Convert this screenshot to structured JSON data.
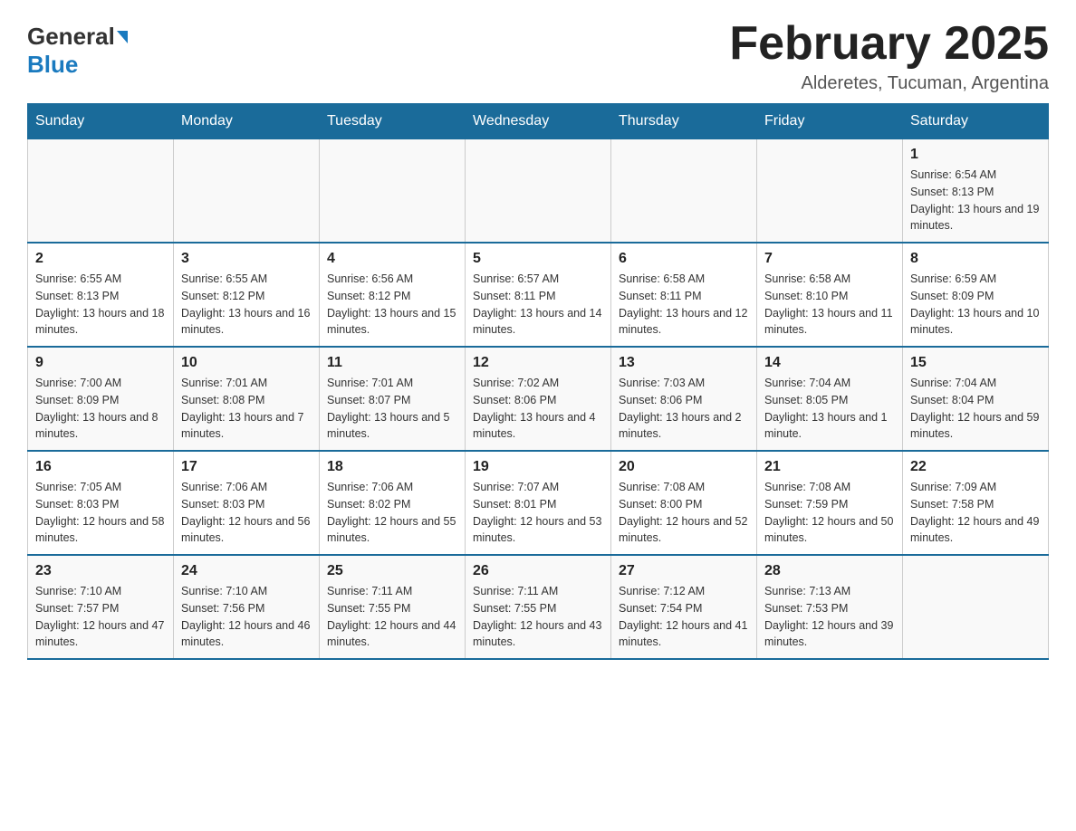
{
  "logo": {
    "general": "General",
    "blue": "Blue",
    "subtitle": "Blue"
  },
  "title": "February 2025",
  "location": "Alderetes, Tucuman, Argentina",
  "weekdays": [
    "Sunday",
    "Monday",
    "Tuesday",
    "Wednesday",
    "Thursday",
    "Friday",
    "Saturday"
  ],
  "weeks": [
    [
      {
        "day": "",
        "info": ""
      },
      {
        "day": "",
        "info": ""
      },
      {
        "day": "",
        "info": ""
      },
      {
        "day": "",
        "info": ""
      },
      {
        "day": "",
        "info": ""
      },
      {
        "day": "",
        "info": ""
      },
      {
        "day": "1",
        "info": "Sunrise: 6:54 AM\nSunset: 8:13 PM\nDaylight: 13 hours and 19 minutes."
      }
    ],
    [
      {
        "day": "2",
        "info": "Sunrise: 6:55 AM\nSunset: 8:13 PM\nDaylight: 13 hours and 18 minutes."
      },
      {
        "day": "3",
        "info": "Sunrise: 6:55 AM\nSunset: 8:12 PM\nDaylight: 13 hours and 16 minutes."
      },
      {
        "day": "4",
        "info": "Sunrise: 6:56 AM\nSunset: 8:12 PM\nDaylight: 13 hours and 15 minutes."
      },
      {
        "day": "5",
        "info": "Sunrise: 6:57 AM\nSunset: 8:11 PM\nDaylight: 13 hours and 14 minutes."
      },
      {
        "day": "6",
        "info": "Sunrise: 6:58 AM\nSunset: 8:11 PM\nDaylight: 13 hours and 12 minutes."
      },
      {
        "day": "7",
        "info": "Sunrise: 6:58 AM\nSunset: 8:10 PM\nDaylight: 13 hours and 11 minutes."
      },
      {
        "day": "8",
        "info": "Sunrise: 6:59 AM\nSunset: 8:09 PM\nDaylight: 13 hours and 10 minutes."
      }
    ],
    [
      {
        "day": "9",
        "info": "Sunrise: 7:00 AM\nSunset: 8:09 PM\nDaylight: 13 hours and 8 minutes."
      },
      {
        "day": "10",
        "info": "Sunrise: 7:01 AM\nSunset: 8:08 PM\nDaylight: 13 hours and 7 minutes."
      },
      {
        "day": "11",
        "info": "Sunrise: 7:01 AM\nSunset: 8:07 PM\nDaylight: 13 hours and 5 minutes."
      },
      {
        "day": "12",
        "info": "Sunrise: 7:02 AM\nSunset: 8:06 PM\nDaylight: 13 hours and 4 minutes."
      },
      {
        "day": "13",
        "info": "Sunrise: 7:03 AM\nSunset: 8:06 PM\nDaylight: 13 hours and 2 minutes."
      },
      {
        "day": "14",
        "info": "Sunrise: 7:04 AM\nSunset: 8:05 PM\nDaylight: 13 hours and 1 minute."
      },
      {
        "day": "15",
        "info": "Sunrise: 7:04 AM\nSunset: 8:04 PM\nDaylight: 12 hours and 59 minutes."
      }
    ],
    [
      {
        "day": "16",
        "info": "Sunrise: 7:05 AM\nSunset: 8:03 PM\nDaylight: 12 hours and 58 minutes."
      },
      {
        "day": "17",
        "info": "Sunrise: 7:06 AM\nSunset: 8:03 PM\nDaylight: 12 hours and 56 minutes."
      },
      {
        "day": "18",
        "info": "Sunrise: 7:06 AM\nSunset: 8:02 PM\nDaylight: 12 hours and 55 minutes."
      },
      {
        "day": "19",
        "info": "Sunrise: 7:07 AM\nSunset: 8:01 PM\nDaylight: 12 hours and 53 minutes."
      },
      {
        "day": "20",
        "info": "Sunrise: 7:08 AM\nSunset: 8:00 PM\nDaylight: 12 hours and 52 minutes."
      },
      {
        "day": "21",
        "info": "Sunrise: 7:08 AM\nSunset: 7:59 PM\nDaylight: 12 hours and 50 minutes."
      },
      {
        "day": "22",
        "info": "Sunrise: 7:09 AM\nSunset: 7:58 PM\nDaylight: 12 hours and 49 minutes."
      }
    ],
    [
      {
        "day": "23",
        "info": "Sunrise: 7:10 AM\nSunset: 7:57 PM\nDaylight: 12 hours and 47 minutes."
      },
      {
        "day": "24",
        "info": "Sunrise: 7:10 AM\nSunset: 7:56 PM\nDaylight: 12 hours and 46 minutes."
      },
      {
        "day": "25",
        "info": "Sunrise: 7:11 AM\nSunset: 7:55 PM\nDaylight: 12 hours and 44 minutes."
      },
      {
        "day": "26",
        "info": "Sunrise: 7:11 AM\nSunset: 7:55 PM\nDaylight: 12 hours and 43 minutes."
      },
      {
        "day": "27",
        "info": "Sunrise: 7:12 AM\nSunset: 7:54 PM\nDaylight: 12 hours and 41 minutes."
      },
      {
        "day": "28",
        "info": "Sunrise: 7:13 AM\nSunset: 7:53 PM\nDaylight: 12 hours and 39 minutes."
      },
      {
        "day": "",
        "info": ""
      }
    ]
  ]
}
